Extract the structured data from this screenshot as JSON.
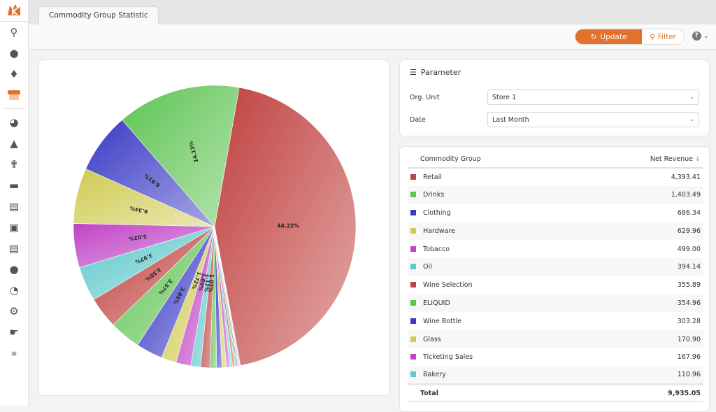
{
  "sidebar": {
    "items": [
      "search",
      "user",
      "notifications",
      "store",
      "dashboard",
      "products",
      "gastronomy",
      "tickets",
      "receipts",
      "vouchers",
      "cash-drawer",
      "customers",
      "statistics",
      "settings",
      "partners",
      "expand"
    ]
  },
  "tab": {
    "title": "Commodity Group Statistic"
  },
  "toolbar": {
    "update_label": "Update",
    "filter_label": "Filter",
    "help_label": "?"
  },
  "colors": {
    "accent": "#e3712b",
    "series": [
      "#c0413f",
      "#5ec452",
      "#3a3ac6",
      "#cfcb52",
      "#c043c6",
      "#5fc9cb"
    ]
  },
  "parameter": {
    "title": "Parameter",
    "org_unit_label": "Org. Unit",
    "org_unit_value": "Store 1",
    "date_label": "Date",
    "date_value": "Last Month"
  },
  "table": {
    "col_group": "Commodity Group",
    "col_revenue": "Net Revenue",
    "sort": "descending",
    "rows": [
      {
        "name": "Retail",
        "value": "4,393.41"
      },
      {
        "name": "Drinks",
        "value": "1,403.49"
      },
      {
        "name": "Clothing",
        "value": "686.34"
      },
      {
        "name": "Hardware",
        "value": "629.96"
      },
      {
        "name": "Tobacco",
        "value": "499.00"
      },
      {
        "name": "Oil",
        "value": "394.14"
      },
      {
        "name": "Wine Selection",
        "value": "355.89"
      },
      {
        "name": "ELIQUID",
        "value": "354.96"
      },
      {
        "name": "Wine Bottle",
        "value": "303.28"
      },
      {
        "name": "Glass",
        "value": "170.90"
      },
      {
        "name": "Ticketing Sales",
        "value": "167.96"
      },
      {
        "name": "Bakery",
        "value": "110.96"
      }
    ],
    "total_label": "Total",
    "total_value": "9,935.05"
  },
  "chart_data": {
    "type": "pie",
    "slices": [
      {
        "name": "Retail",
        "percent": 44.22
      },
      {
        "name": "Drinks",
        "percent": 14.13
      },
      {
        "name": "Clothing",
        "percent": 6.91
      },
      {
        "name": "Hardware",
        "percent": 6.34
      },
      {
        "name": "Tobacco",
        "percent": 5.02
      },
      {
        "name": "Oil",
        "percent": 3.97
      },
      {
        "name": "Wine Selection",
        "percent": 3.58
      },
      {
        "name": "ELIQUID",
        "percent": 3.57
      },
      {
        "name": "Wine Bottle",
        "percent": 3.05
      },
      {
        "name": "Glass",
        "percent": 1.72
      },
      {
        "name": "Ticketing Sales",
        "percent": 1.69
      },
      {
        "name": "Bakery",
        "percent": 1.12
      },
      {
        "percent": 1.07
      },
      {
        "percent": 0.75
      },
      {
        "percent": 0.6
      },
      {
        "percent": 0.5
      },
      {
        "percent": 0.4
      },
      {
        "percent": 0.3
      },
      {
        "percent": 0.25
      },
      {
        "percent": 0.2
      },
      {
        "percent": 0.15
      },
      {
        "percent": 0.1
      },
      {
        "percent": 0.1
      },
      {
        "percent": 0.08
      }
    ]
  }
}
